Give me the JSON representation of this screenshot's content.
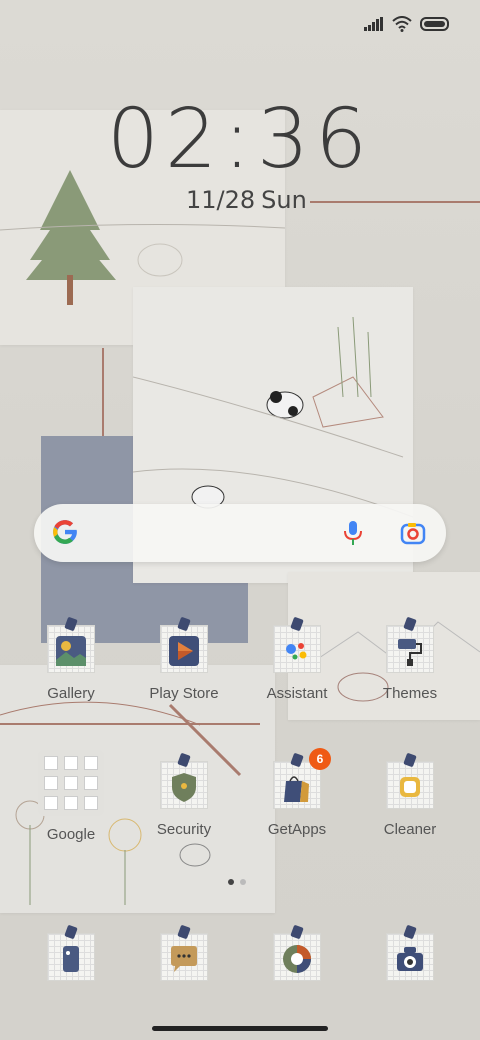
{
  "status_bar": {
    "icons": [
      "signal-icon",
      "wifi-icon",
      "battery-icon"
    ]
  },
  "lockscreen": {
    "time": "02:36",
    "date": "11/28",
    "day": "Sun"
  },
  "search": {
    "icons": [
      "google-logo",
      "mic-icon",
      "lens-icon"
    ]
  },
  "apps": {
    "row1": [
      {
        "label": "Gallery"
      },
      {
        "label": "Play Store"
      },
      {
        "label": "Assistant"
      },
      {
        "label": "Themes"
      }
    ],
    "row2": [
      {
        "label": "Google"
      },
      {
        "label": "Security"
      },
      {
        "label": "GetApps",
        "badge": "6"
      },
      {
        "label": "Cleaner"
      }
    ]
  },
  "dock": [
    "phone-icon",
    "messages-icon",
    "browser-icon",
    "camera-icon"
  ],
  "page_indicator": {
    "total": 2,
    "active": 1
  },
  "colors": {
    "accent_line": "#a97b6e",
    "slate": "#8f96a6",
    "badge": "#ef5a14",
    "tape": "#3e4a70"
  }
}
